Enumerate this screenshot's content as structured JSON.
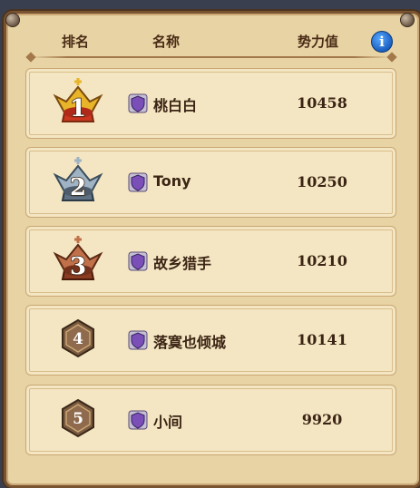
{
  "header": {
    "rank_label": "排名",
    "name_label": "名称",
    "power_label": "势力值",
    "info_label": "i"
  },
  "rows": [
    {
      "rank": "1",
      "name": "桃白白",
      "power": "10458",
      "badge": "gold-crown"
    },
    {
      "rank": "2",
      "name": "Tony",
      "power": "10250",
      "badge": "silver-crown"
    },
    {
      "rank": "3",
      "name": "故乡猎手",
      "power": "10210",
      "badge": "bronze-crown"
    },
    {
      "rank": "4",
      "name": "落寞也倾城",
      "power": "10141",
      "badge": "hexagon"
    },
    {
      "rank": "5",
      "name": "小间",
      "power": "9920",
      "badge": "hexagon"
    }
  ],
  "icons": {
    "guild_shield": "purple-shield-icon",
    "info": "info-icon"
  },
  "colors": {
    "gold": "#e8b429",
    "silver": "#9fb3c4",
    "bronze": "#c0714a",
    "shield_purple": "#7b4fb8",
    "text_brown": "#3b2414"
  }
}
